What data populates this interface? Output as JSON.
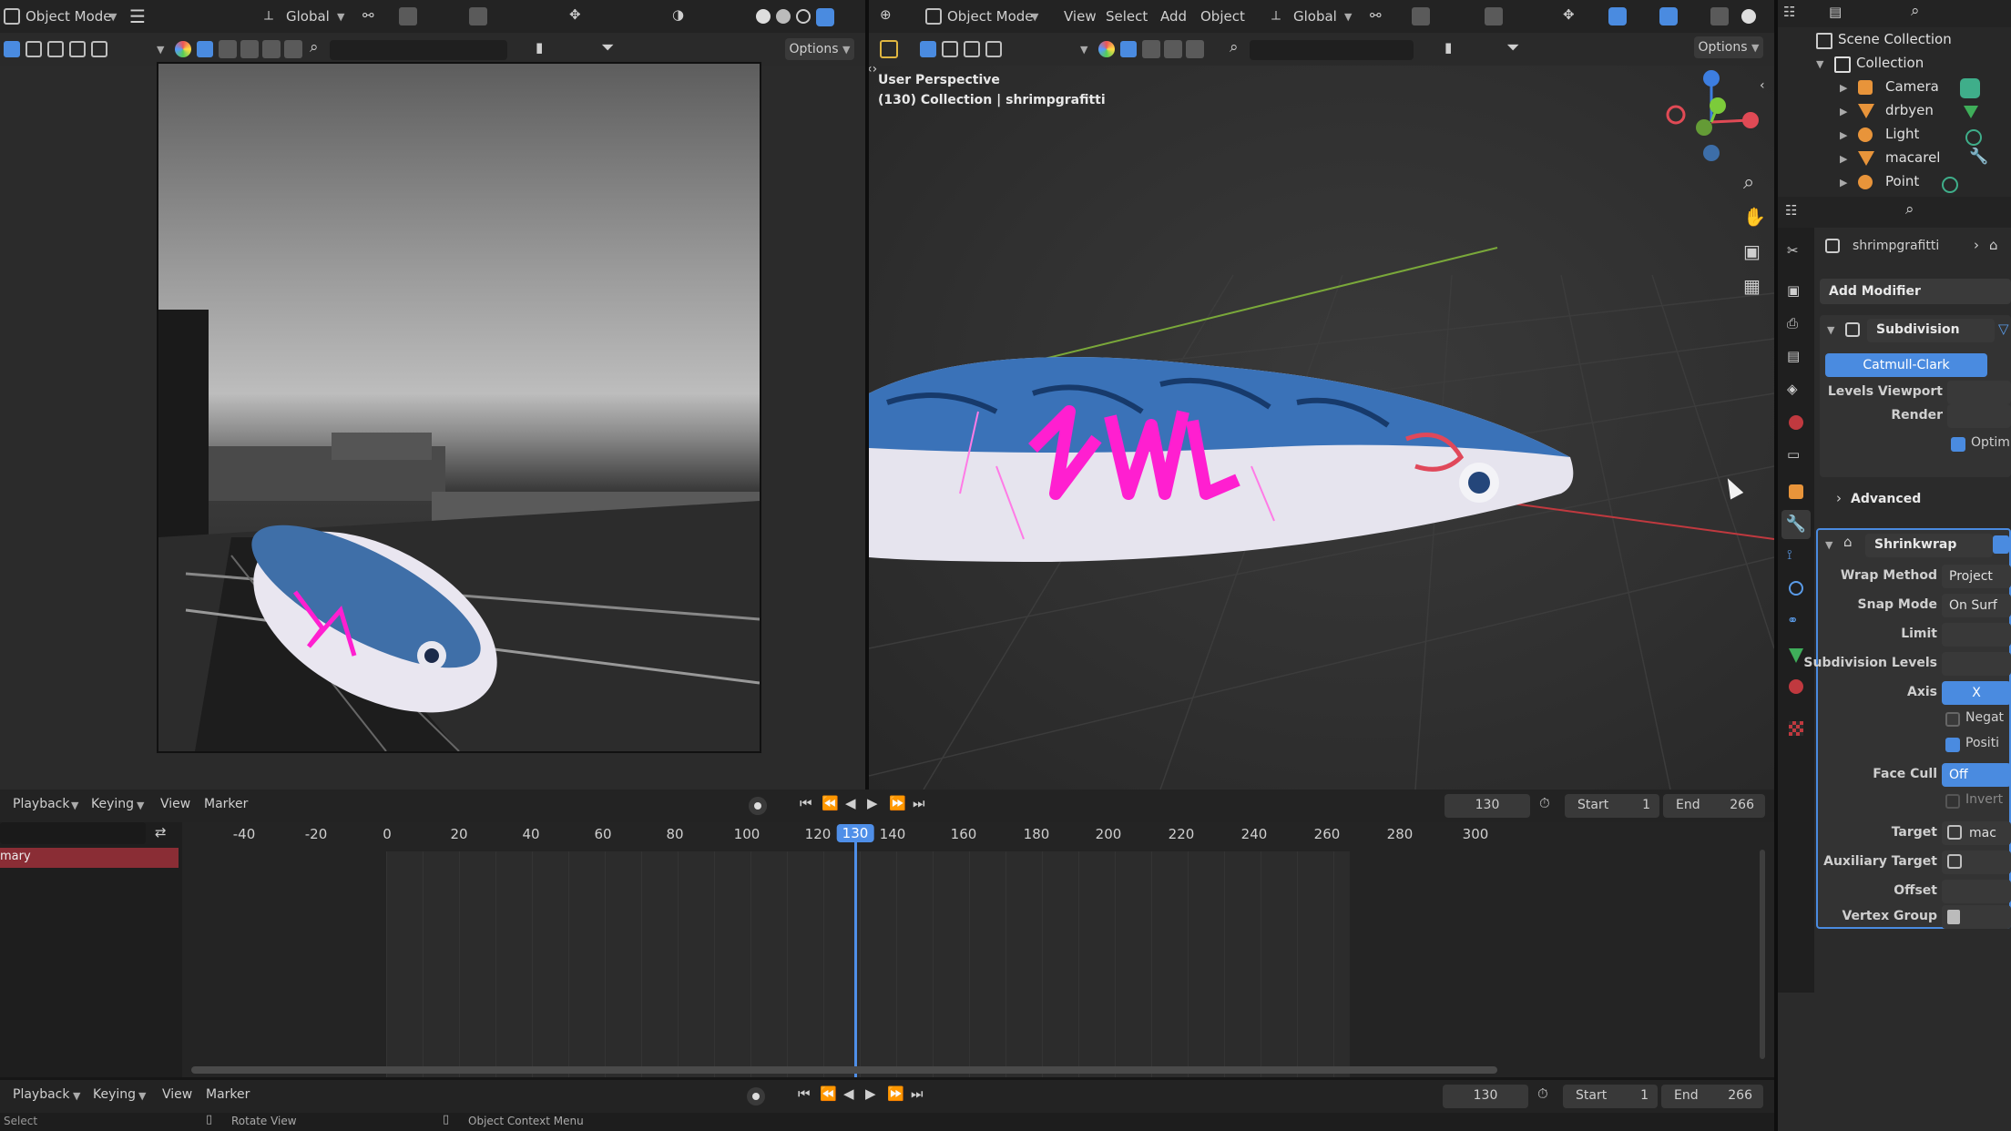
{
  "left_header": {
    "mode": "Object Mode",
    "orientation": "Global",
    "options": "Options"
  },
  "viewport_header": {
    "mode": "Object Mode",
    "menus": [
      "View",
      "Select",
      "Add",
      "Object"
    ],
    "orientation": "Global",
    "options": "Options"
  },
  "viewport": {
    "perspective_label": "User Perspective",
    "context_label": "(130) Collection | shrimpgrafitti"
  },
  "outliner": {
    "scene_collection": "Scene Collection",
    "collection": "Collection",
    "items": [
      "Camera",
      "drbyen",
      "Light",
      "macarel",
      "Point"
    ]
  },
  "properties": {
    "object_name": "shrimpgrafitti",
    "add_modifier": "Add Modifier",
    "subdivision": {
      "name": "Subdivision",
      "method": "Catmull-Clark",
      "levels_viewport_label": "Levels Viewport",
      "render_label": "Render",
      "optimal_label": "Optim",
      "advanced_label": "Advanced"
    },
    "shrinkwrap": {
      "name": "Shrinkwrap",
      "wrap_method_label": "Wrap Method",
      "wrap_method_value": "Project",
      "snap_mode_label": "Snap Mode",
      "snap_mode_value": "On Surf",
      "limit_label": "Limit",
      "subdivision_levels_label": "Subdivision Levels",
      "axis_label": "Axis",
      "axis_value": "X",
      "negative_label": "Negat",
      "positive_label": "Positi",
      "face_cull_label": "Face Cull",
      "face_cull_value": "Off",
      "invert_label": "Invert",
      "target_label": "Target",
      "target_value": "mac",
      "aux_target_label": "Auxiliary Target",
      "offset_label": "Offset",
      "vertex_group_label": "Vertex Group"
    }
  },
  "timeline": {
    "menus": [
      "Playback",
      "Keying",
      "View",
      "Marker"
    ],
    "current_frame": "130",
    "start_label": "Start",
    "start_value": "1",
    "end_label": "End",
    "end_value": "266",
    "ticks": [
      "-40",
      "-20",
      "0",
      "20",
      "40",
      "60",
      "80",
      "100",
      "120",
      "130",
      "140",
      "160",
      "180",
      "200",
      "220",
      "240",
      "260",
      "280",
      "300"
    ],
    "track_label": "mary"
  },
  "bottom_timeline": {
    "menus": [
      "Playback",
      "Keying",
      "View",
      "Marker"
    ],
    "current_frame": "130",
    "start_label": "Start",
    "start_value": "1",
    "end_label": "End",
    "end_value": "266"
  },
  "status_bar": {
    "select": "Select",
    "rotate_view": "Rotate View",
    "context_menu": "Object Context Menu"
  },
  "colors": {
    "accent_blue": "#4a8be0",
    "graffiti_magenta": "#ff1fd0",
    "playhead_blue": "#4f8fe8"
  }
}
